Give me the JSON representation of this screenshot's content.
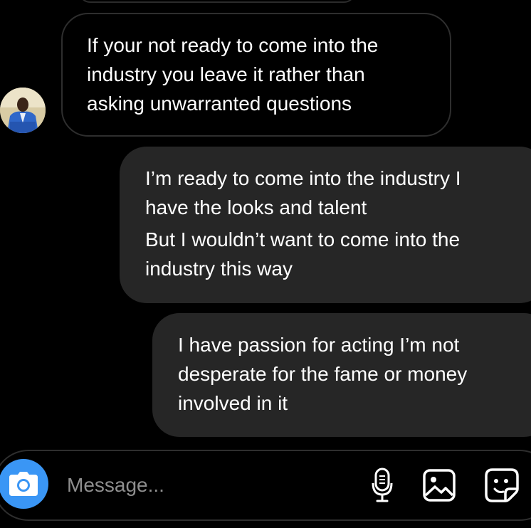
{
  "conversation": {
    "messages": [
      {
        "direction": "received",
        "lines": [
          "If your not ready to come into the",
          "industry you leave it rather than",
          "asking unwarranted questions"
        ]
      },
      {
        "direction": "sent",
        "lines": [
          "I’m ready to come into the industry I",
          "have the looks and talent",
          "But I wouldn’t want to come into the",
          "industry this way"
        ]
      },
      {
        "direction": "sent",
        "lines": [
          "I have passion for acting I’m not",
          "desperate for the fame or money",
          "involved in it"
        ]
      }
    ]
  },
  "composer": {
    "placeholder": "Message..."
  },
  "colors": {
    "background": "#000000",
    "sent_bubble": "#262626",
    "received_border": "#2e2e2e",
    "accent_camera": "#3a96f5",
    "placeholder_text": "#8e8e8e"
  },
  "icons": {
    "camera": "camera-icon",
    "microphone": "microphone-icon",
    "gallery": "gallery-icon",
    "sticker": "sticker-icon"
  }
}
